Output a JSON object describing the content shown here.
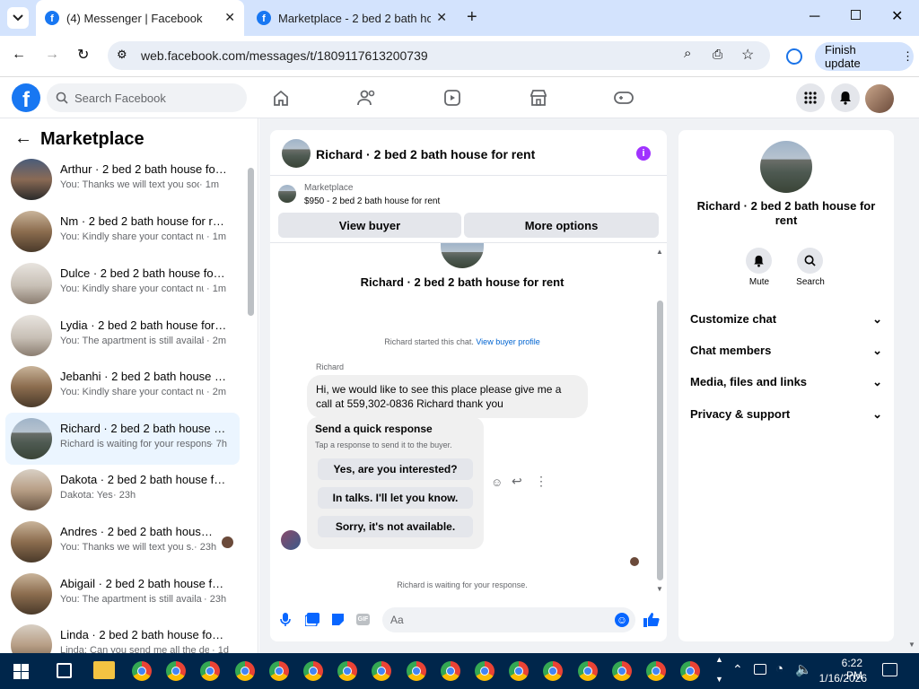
{
  "browser": {
    "tabs": [
      {
        "title": "(4) Messenger | Facebook",
        "active": true
      },
      {
        "title": "Marketplace - 2 bed 2 bath hou",
        "active": false
      }
    ],
    "url": "web.facebook.com/messages/t/1809117613200739",
    "finish_update": "Finish update"
  },
  "fb": {
    "search_placeholder": "Search Facebook"
  },
  "sidebar": {
    "title": "Marketplace",
    "conversations": [
      {
        "name": "Arthur · 2 bed 2 bath house for ...",
        "preview": "You: Thanks we will text you soon",
        "time": "· 1m"
      },
      {
        "name": "Nm · 2 bed 2 bath house for rent",
        "preview": "You: Kindly share your contact nu...",
        "time": "· 1m"
      },
      {
        "name": "Dulce · 2 bed 2 bath house for r...",
        "preview": "You: Kindly share your contact nu...",
        "time": "· 1m"
      },
      {
        "name": "Lydia · 2 bed 2 bath house for r...",
        "preview": "You: The apartment is still availabl...",
        "time": "· 2m"
      },
      {
        "name": "Jebanhi · 2 bed 2 bath house fo...",
        "preview": "You: Kindly share your contact nu...",
        "time": "· 2m"
      },
      {
        "name": "Richard · 2 bed 2 bath house fo...",
        "preview": "Richard is waiting for your response.",
        "time": "· 7h"
      },
      {
        "name": "Dakota · 2 bed 2 bath house for...",
        "preview": "Dakota: Yes",
        "time": "· 23h"
      },
      {
        "name": "Andres · 2 bed 2 bath house f...",
        "preview": "You: Thanks we will text you s...",
        "time": "· 23h"
      },
      {
        "name": "Abigail · 2 bed 2 bath house for...",
        "preview": "You: The apartment is still availabl...",
        "time": "· 23h"
      },
      {
        "name": "Linda · 2 bed 2 bath house for r...",
        "preview": "Linda: Can you send me all the det...",
        "time": "· 1d"
      }
    ]
  },
  "chat": {
    "header_title": "Richard · 2 bed 2 bath house for rent",
    "listing_label": "Marketplace",
    "listing_price": "$950 - 2 bed 2 bath house for rent",
    "view_buyer": "View buyer",
    "more_options": "More options",
    "intro_title": "Richard · 2 bed 2 bath house for rent",
    "started_text": "Richard started this chat.",
    "view_buyer_profile": "View buyer profile",
    "sender": "Richard",
    "message": "Hi, we would like to see this place please give me a call at 559,302-0836 Richard thank you",
    "quick_title": "Send a quick response",
    "quick_subtitle": "Tap a response to send it to the buyer.",
    "quick_replies": [
      "Yes, are you interested?",
      "In talks. I'll let you know.",
      "Sorry, it's not available."
    ],
    "waiting": "Richard is waiting for your response.",
    "input_placeholder": "Aa"
  },
  "details": {
    "title": "Richard · 2 bed 2 bath house for rent",
    "mute": "Mute",
    "search": "Search",
    "sections": [
      "Customize chat",
      "Chat members",
      "Media, files and links",
      "Privacy & support"
    ]
  },
  "taskbar": {
    "time": "6:22 PM",
    "date": "1/16/2026"
  },
  "colors": {
    "fb_blue": "#1877f2",
    "active_conv": "#ebf5ff",
    "info_purple": "#a033ff",
    "taskbar": "#00264b"
  }
}
